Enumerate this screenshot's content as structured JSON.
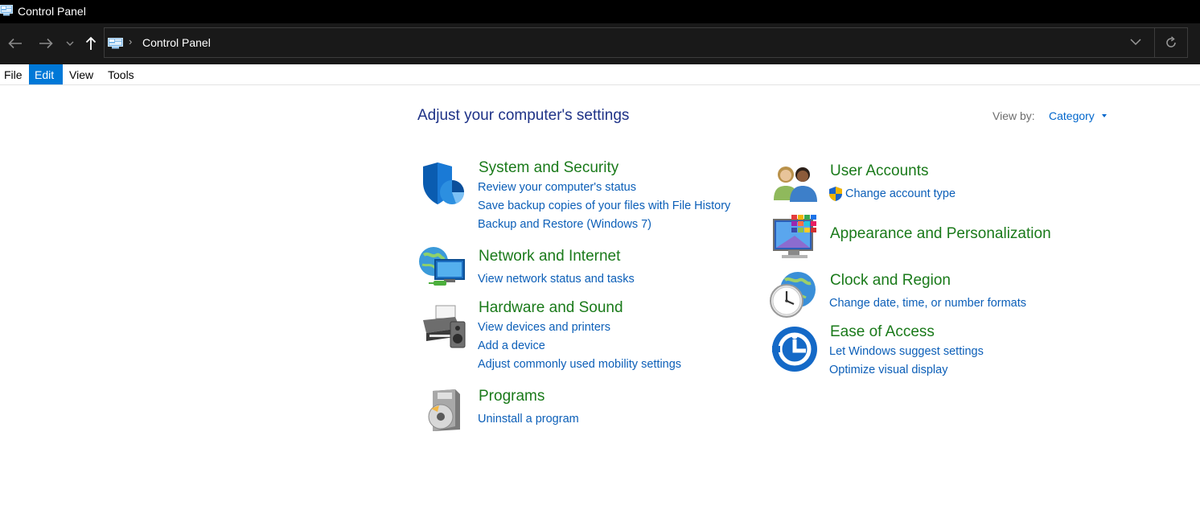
{
  "window": {
    "title": "Control Panel"
  },
  "address": {
    "breadcrumb": "Control Panel"
  },
  "menu": [
    "File",
    "Edit",
    "View",
    "Tools"
  ],
  "content": {
    "heading": "Adjust your computer's settings",
    "view_by_label": "View by:",
    "view_by_value": "Category",
    "categories": [
      {
        "title": "System and Security",
        "icon": "shield-icon",
        "links": [
          "Review your computer's status",
          "Save backup copies of your files with File History",
          "Backup and Restore (Windows 7)"
        ]
      },
      {
        "title": "Network and Internet",
        "icon": "network-globe-icon",
        "links": [
          "View network status and tasks"
        ]
      },
      {
        "title": "Hardware and Sound",
        "icon": "printer-speaker-icon",
        "links": [
          "View devices and printers",
          "Add a device",
          "Adjust commonly used mobility settings"
        ]
      },
      {
        "title": "Programs",
        "icon": "programs-disc-icon",
        "links": [
          "Uninstall a program"
        ]
      },
      {
        "title": "User Accounts",
        "icon": "users-icon",
        "links": [
          "Change account type"
        ],
        "link_icon": "uac-shield-icon"
      },
      {
        "title": "Appearance and Personalization",
        "icon": "monitor-palette-icon",
        "links": []
      },
      {
        "title": "Clock and Region",
        "icon": "clock-globe-icon",
        "links": [
          "Change date, time, or number formats"
        ]
      },
      {
        "title": "Ease of Access",
        "icon": "ease-of-access-icon",
        "links": [
          "Let Windows suggest settings",
          "Optimize visual display"
        ]
      }
    ]
  },
  "colors": {
    "titlebar_bg": "#000000",
    "navbar_bg": "#191919",
    "menu_active_bg": "#0078d7",
    "heading_text": "#1e3287",
    "category_title": "#1a7a1a",
    "link_text": "#0c5fb8"
  }
}
